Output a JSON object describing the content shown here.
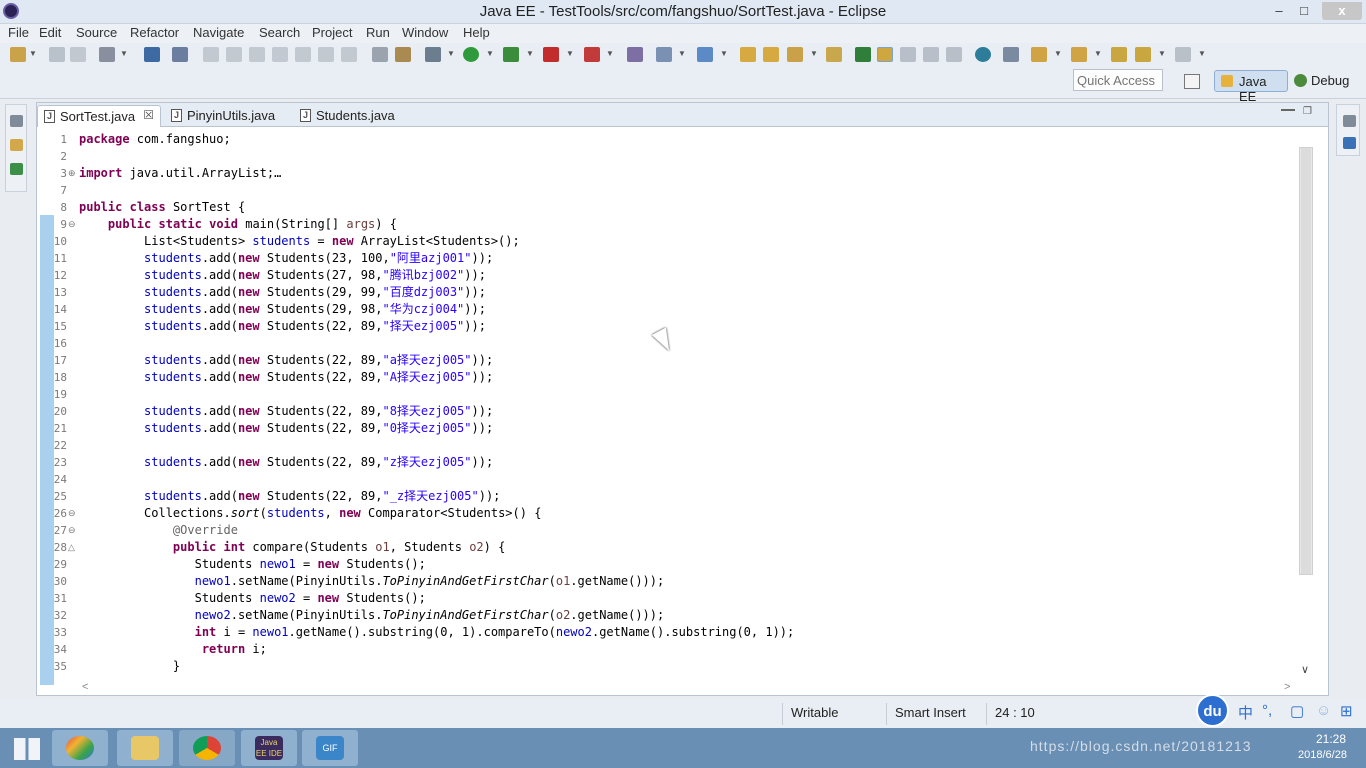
{
  "window": {
    "title": "Java EE - TestTools/src/com/fangshuo/SortTest.java - Eclipse",
    "min_glyph": "–",
    "max_glyph": "□",
    "close_glyph": "x"
  },
  "menu": [
    "File",
    "Edit",
    "Source",
    "Refactor",
    "Navigate",
    "Search",
    "Project",
    "Run",
    "Window",
    "Help"
  ],
  "quick_access": {
    "placeholder": "Quick Access"
  },
  "perspectives": {
    "java_ee": "Java EE",
    "debug": "Debug"
  },
  "editor": {
    "tabs": [
      {
        "label": "SortTest.java",
        "active": true,
        "icon": "java-file-icon"
      },
      {
        "label": "PinyinUtils.java",
        "active": false,
        "icon": "java-file-icon"
      },
      {
        "label": "Students.java",
        "active": false,
        "icon": "java-file-icon"
      }
    ],
    "close_glyph": "☒",
    "lines": [
      {
        "n": "1",
        "text": "package com.fangshuo;"
      },
      {
        "n": "2",
        "text": ""
      },
      {
        "n": "3",
        "text": "import java.util.ArrayList;…",
        "fold": "⊕"
      },
      {
        "n": "7",
        "text": ""
      },
      {
        "n": "8",
        "text": "public class SortTest {"
      },
      {
        "n": "9",
        "text": "    public static void main(String[] args) {",
        "fold": "⊖"
      },
      {
        "n": "10",
        "text": "         List<Students> students = new ArrayList<Students>();"
      },
      {
        "n": "11",
        "text": "         students.add(new Students(23, 100,\"阿里azj001\"));"
      },
      {
        "n": "12",
        "text": "         students.add(new Students(27, 98,\"腾讯bzj002\"));"
      },
      {
        "n": "13",
        "text": "         students.add(new Students(29, 99,\"百度dzj003\"));"
      },
      {
        "n": "14",
        "text": "         students.add(new Students(29, 98,\"华为czj004\"));"
      },
      {
        "n": "15",
        "text": "         students.add(new Students(22, 89,\"择天ezj005\"));"
      },
      {
        "n": "16",
        "text": ""
      },
      {
        "n": "17",
        "text": "         students.add(new Students(22, 89,\"a择天ezj005\"));"
      },
      {
        "n": "18",
        "text": "         students.add(new Students(22, 89,\"A择天ezj005\"));"
      },
      {
        "n": "19",
        "text": ""
      },
      {
        "n": "20",
        "text": "         students.add(new Students(22, 89,\"8择天ezj005\"));"
      },
      {
        "n": "21",
        "text": "         students.add(new Students(22, 89,\"0择天ezj005\"));"
      },
      {
        "n": "22",
        "text": ""
      },
      {
        "n": "23",
        "text": "         students.add(new Students(22, 89,\"z择天ezj005\"));"
      },
      {
        "n": "24",
        "text": ""
      },
      {
        "n": "25",
        "text": "         students.add(new Students(22, 89,\"_z择天ezj005\"));"
      },
      {
        "n": "26",
        "text": "         Collections.sort(students, new Comparator<Students>() {",
        "fold": "⊖"
      },
      {
        "n": "27",
        "text": "             @Override",
        "fold": "⊖"
      },
      {
        "n": "28",
        "text": "             public int compare(Students o1, Students o2) {",
        "fold": "△"
      },
      {
        "n": "29",
        "text": "                Students newo1 = new Students();"
      },
      {
        "n": "30",
        "text": "                newo1.setName(PinyinUtils.ToPinyinAndGetFirstChar(o1.getName()));"
      },
      {
        "n": "31",
        "text": "                Students newo2 = new Students();"
      },
      {
        "n": "32",
        "text": "                newo2.setName(PinyinUtils.ToPinyinAndGetFirstChar(o2.getName()));"
      },
      {
        "n": "33",
        "text": "                int i = newo1.getName().substring(0, 1).compareTo(newo2.getName().substring(0, 1));"
      },
      {
        "n": "34",
        "text": "                 return i;"
      },
      {
        "n": "35",
        "text": "             }"
      }
    ]
  },
  "status": {
    "writable": "Writable",
    "insert_mode": "Smart Insert",
    "position": "24 : 10"
  },
  "ime": {
    "logo": "du",
    "zh": "中",
    "punct": "°,"
  },
  "taskbar": {
    "tray_url": "https://blog.csdn.net/20181213",
    "time": "21:28",
    "date": "2018/6/28",
    "java_ee_ide_label": "Java EE IDE",
    "gif_label": "GIF"
  },
  "colors": {
    "keyword": "#7f0055",
    "string": "#2a00ff",
    "annotation": "#646464",
    "field": "#0000c0",
    "accent": "#2d6fd1"
  }
}
